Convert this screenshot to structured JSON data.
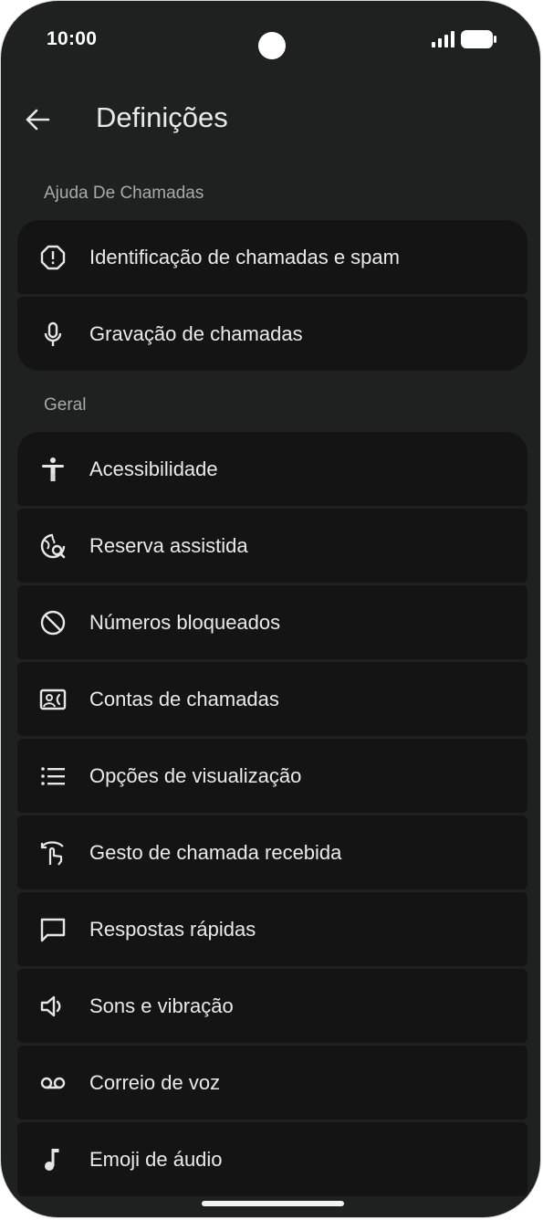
{
  "status_bar": {
    "time": "10:00"
  },
  "header": {
    "title": "Definições"
  },
  "sections": [
    {
      "title": "Ajuda De Chamadas",
      "items": [
        {
          "label": "Identificação de chamadas e spam",
          "icon": "alert-octagon-icon"
        },
        {
          "label": "Gravação de chamadas",
          "icon": "microphone-icon"
        }
      ]
    },
    {
      "title": "Geral",
      "items": [
        {
          "label": "Acessibilidade",
          "icon": "accessibility-icon"
        },
        {
          "label": "Reserva assistida",
          "icon": "globe-search-icon"
        },
        {
          "label": "Números bloqueados",
          "icon": "block-icon"
        },
        {
          "label": "Contas de chamadas",
          "icon": "contact-card-icon"
        },
        {
          "label": "Opções de visualização",
          "icon": "list-icon"
        },
        {
          "label": "Gesto de chamada recebida",
          "icon": "gesture-icon"
        },
        {
          "label": "Respostas rápidas",
          "icon": "chat-bubble-icon"
        },
        {
          "label": "Sons e vibração",
          "icon": "speaker-icon"
        },
        {
          "label": "Correio de voz",
          "icon": "voicemail-icon"
        },
        {
          "label": "Emoji de áudio",
          "icon": "music-note-icon"
        }
      ]
    }
  ]
}
